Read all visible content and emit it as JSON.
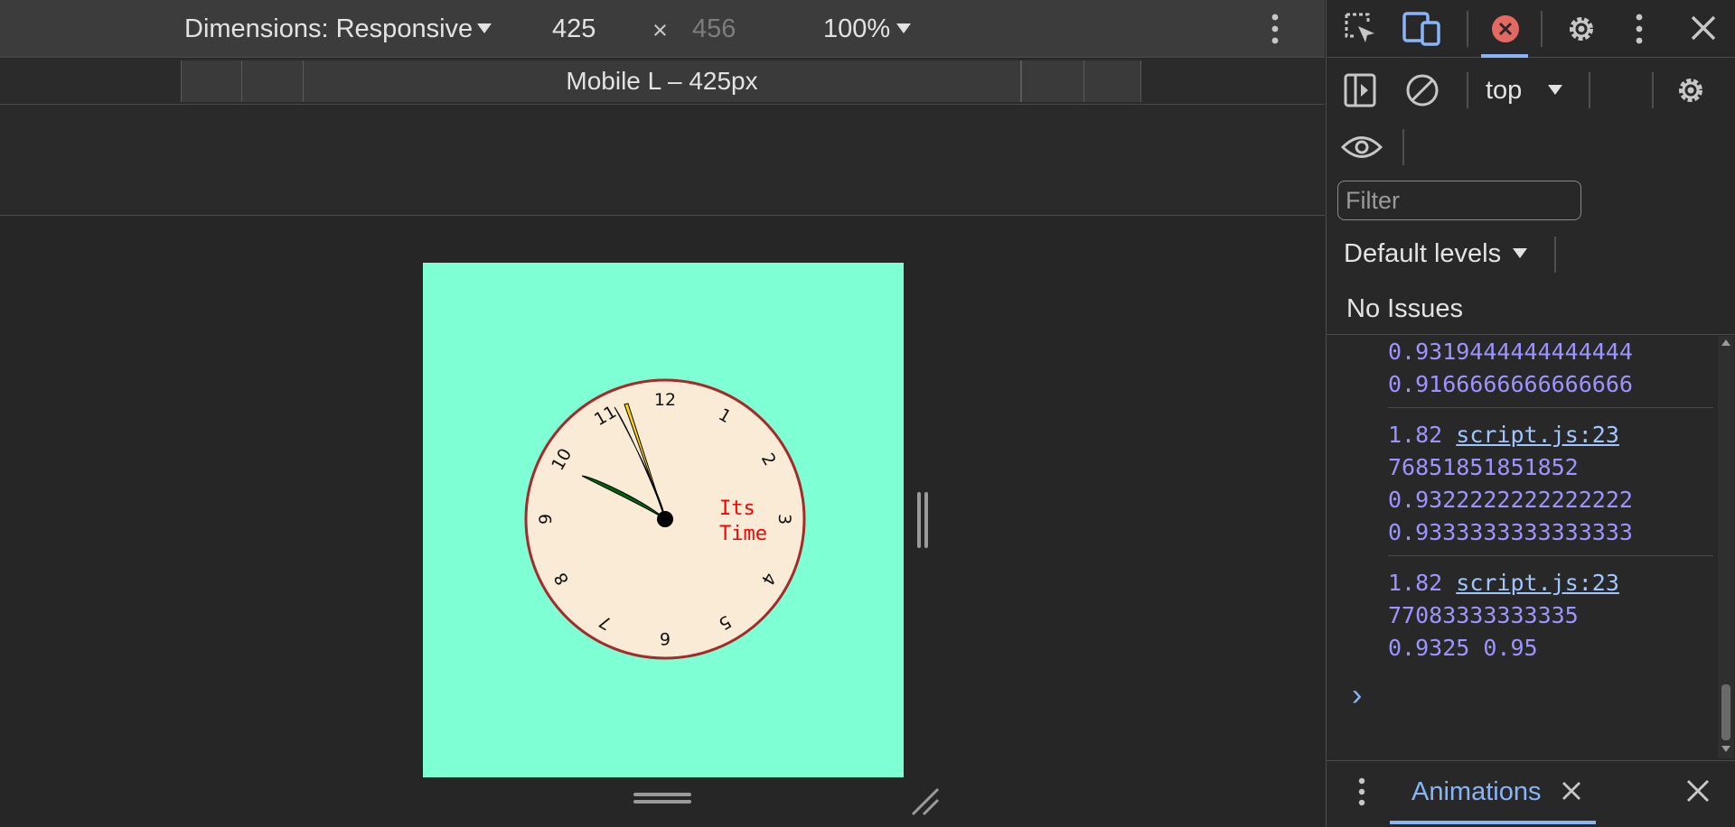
{
  "toolbar": {
    "dimensions_label": "Dimensions: Responsive",
    "width_value": "425",
    "times": "×",
    "height_value": "456",
    "zoom": "100%"
  },
  "ruler": {
    "device_label": "Mobile L – 425px"
  },
  "clock": {
    "numerals": [
      "12",
      "1",
      "2",
      "3",
      "4",
      "5",
      "6",
      "7",
      "8",
      "9",
      "10",
      "11"
    ],
    "caption_line1": "Its",
    "caption_line2": "Time",
    "face_color": "#faebd7",
    "rim_color": "#a52a2a",
    "caption_color": "#ff0000",
    "background": "#7fffd4"
  },
  "devtools": {
    "context": "top",
    "filter_placeholder": "Filter",
    "levels": "Default levels",
    "issues": "No Issues",
    "console": {
      "group1": [
        "0.9319444444444444",
        "0.9166666666666666"
      ],
      "group2_prefix": "1.82",
      "group2_link": "script.js:23",
      "group2_lines": [
        "76851851851852",
        "0.9322222222222222",
        "0.9333333333333333"
      ],
      "group3_prefix": "1.82",
      "group3_link": "script.js:23",
      "group3_lines": [
        "77083333333335",
        "0.9325 0.95"
      ],
      "prompt": "›"
    },
    "drawer_tab": "Animations"
  },
  "icons": {
    "inspect": "inspect-element-icon",
    "device": "device-toolbar-icon",
    "error": "error-badge-icon",
    "settings": "settings-icon",
    "more": "more-vert-icon",
    "close": "close-icon"
  }
}
